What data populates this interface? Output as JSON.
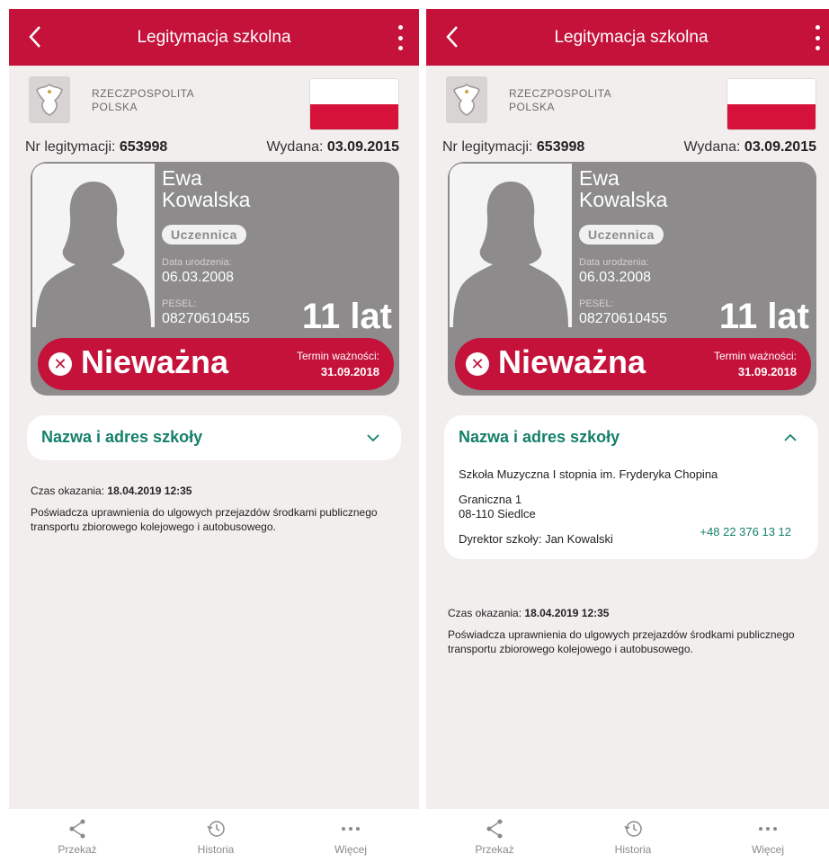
{
  "screens": [
    {
      "appbar": {
        "title": "Legitymacja szkolna"
      },
      "issuer": {
        "line1": "RZECZPOSPOLITA",
        "line2": "POLSKA"
      },
      "numbers": {
        "nr_label": "Nr legitymacji: ",
        "nr_value": "653998",
        "issued_label": "Wydana: ",
        "issued_value": "03.09.2015"
      },
      "card": {
        "first_name": "Ewa",
        "last_name": "Kowalska",
        "role": "Uczennica",
        "dob_label": "Data urodzenia:",
        "dob_value": "06.03.2008",
        "pesel_label": "PESEL:",
        "pesel_value": "08270610455",
        "age": "11 lat"
      },
      "status": {
        "text": "Nieważna",
        "expiry_label": "Termin ważności:",
        "expiry_value": "31.09.2018"
      },
      "school": {
        "header": "Nazwa i adres szkoły",
        "expanded": false
      },
      "info": {
        "shown_label": "Czas okazania: ",
        "shown_value": "18.04.2019 12:35",
        "description": "Poświadcza uprawnienia do ulgowych przejazdów środkami publicznego transportu zbiorowego kolejowego i autobusowego."
      },
      "nav": {
        "share": "Przekaż",
        "history": "Historia",
        "more": "Więcej"
      }
    },
    {
      "appbar": {
        "title": "Legitymacja szkolna"
      },
      "issuer": {
        "line1": "RZECZPOSPOLITA",
        "line2": "POLSKA"
      },
      "numbers": {
        "nr_label": "Nr legitymacji: ",
        "nr_value": "653998",
        "issued_label": "Wydana: ",
        "issued_value": "03.09.2015"
      },
      "card": {
        "first_name": "Ewa",
        "last_name": "Kowalska",
        "role": "Uczennica",
        "dob_label": "Data urodzenia:",
        "dob_value": "06.03.2008",
        "pesel_label": "PESEL:",
        "pesel_value": "08270610455",
        "age": "11 lat"
      },
      "status": {
        "text": "Nieważna",
        "expiry_label": "Termin ważności:",
        "expiry_value": "31.09.2018"
      },
      "school": {
        "header": "Nazwa i adres szkoły",
        "expanded": true,
        "school_name": "Szkoła Muzyczna I stopnia im. Fryderyka Chopina",
        "street": "Graniczna 1",
        "city": "08-110 Siedlce",
        "phone": "+48 22 376 13 12",
        "director": "Dyrektor szkoły: Jan Kowalski"
      },
      "info": {
        "shown_label": "Czas okazania: ",
        "shown_value": "18.04.2019 12:35",
        "description": "Poświadcza uprawnienia do ulgowych przejazdów środkami publicznego transportu zbiorowego kolejowego i autobusowego."
      },
      "nav": {
        "share": "Przekaż",
        "history": "Historia",
        "more": "Więcej"
      }
    }
  ],
  "colors": {
    "brand_red": "#c4123b",
    "accent_green": "#15806b",
    "card_gray": "#8d8b8b"
  }
}
